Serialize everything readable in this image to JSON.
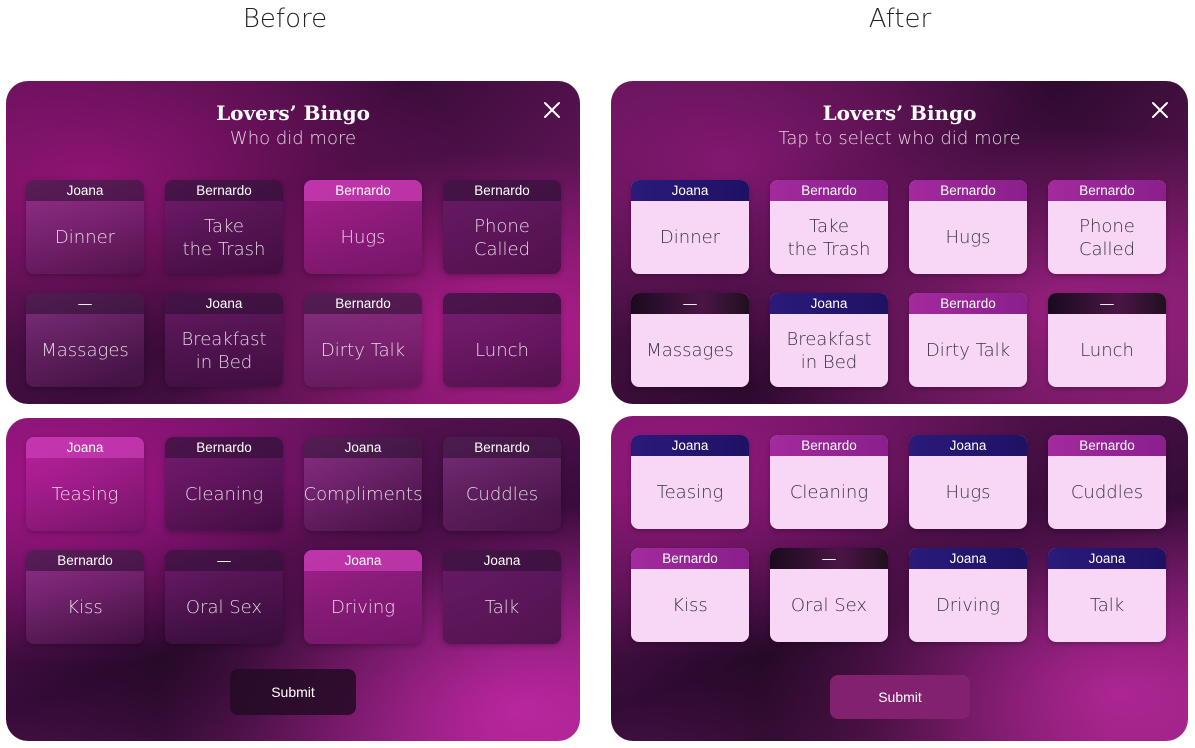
{
  "headings": {
    "before": "Before",
    "after": "After"
  },
  "before": {
    "title": "Lovers’ Bingo",
    "subtitle": "Who did more",
    "top_cards": [
      {
        "name": "Joana",
        "label": "Dinner"
      },
      {
        "name": "Bernardo",
        "label": "Take\nthe Trash"
      },
      {
        "name": "Bernardo",
        "label": "Hugs"
      },
      {
        "name": "Bernardo",
        "label": "Phone\nCalled"
      },
      {
        "name": "—",
        "label": "Massages"
      },
      {
        "name": "Joana",
        "label": "Breakfast\nin Bed"
      },
      {
        "name": "Bernardo",
        "label": "Dirty Talk"
      },
      {
        "name": "",
        "label": "Lunch"
      }
    ],
    "bottom_cards": [
      {
        "name": "Joana",
        "label": "Teasing"
      },
      {
        "name": "Bernardo",
        "label": "Cleaning"
      },
      {
        "name": "Joana",
        "label": "Compliments"
      },
      {
        "name": "Bernardo",
        "label": "Cuddles"
      },
      {
        "name": "Bernardo",
        "label": "Kiss"
      },
      {
        "name": "—",
        "label": "Oral Sex"
      },
      {
        "name": "Joana",
        "label": "Driving"
      },
      {
        "name": "Joana",
        "label": "Talk"
      }
    ],
    "submit": "Submit"
  },
  "after": {
    "title": "Lovers’ Bingo",
    "subtitle": "Tap to select who did more",
    "top_cards": [
      {
        "name": "Joana",
        "label": "Dinner"
      },
      {
        "name": "Bernardo",
        "label": "Take\nthe Trash"
      },
      {
        "name": "Bernardo",
        "label": "Hugs"
      },
      {
        "name": "Bernardo",
        "label": "Phone\nCalled"
      },
      {
        "name": "—",
        "label": "Massages"
      },
      {
        "name": "Joana",
        "label": "Breakfast\nin Bed"
      },
      {
        "name": "Bernardo",
        "label": "Dirty Talk"
      },
      {
        "name": "—",
        "label": "Lunch"
      }
    ],
    "bottom_cards": [
      {
        "name": "Joana",
        "label": "Teasing"
      },
      {
        "name": "Bernardo",
        "label": "Cleaning"
      },
      {
        "name": "Joana",
        "label": "Hugs"
      },
      {
        "name": "Bernardo",
        "label": "Cuddles"
      },
      {
        "name": "Bernardo",
        "label": "Kiss"
      },
      {
        "name": "—",
        "label": "Oral Sex"
      },
      {
        "name": "Joana",
        "label": "Driving"
      },
      {
        "name": "Joana",
        "label": "Talk"
      }
    ],
    "submit": "Submit"
  },
  "colors": {
    "joana_header": "#241870",
    "bernardo_header": "#9a259a",
    "after_card_bg": "#f8d6f6",
    "panel_base": "#4a0f46"
  },
  "icons": {
    "close": "close-icon"
  }
}
